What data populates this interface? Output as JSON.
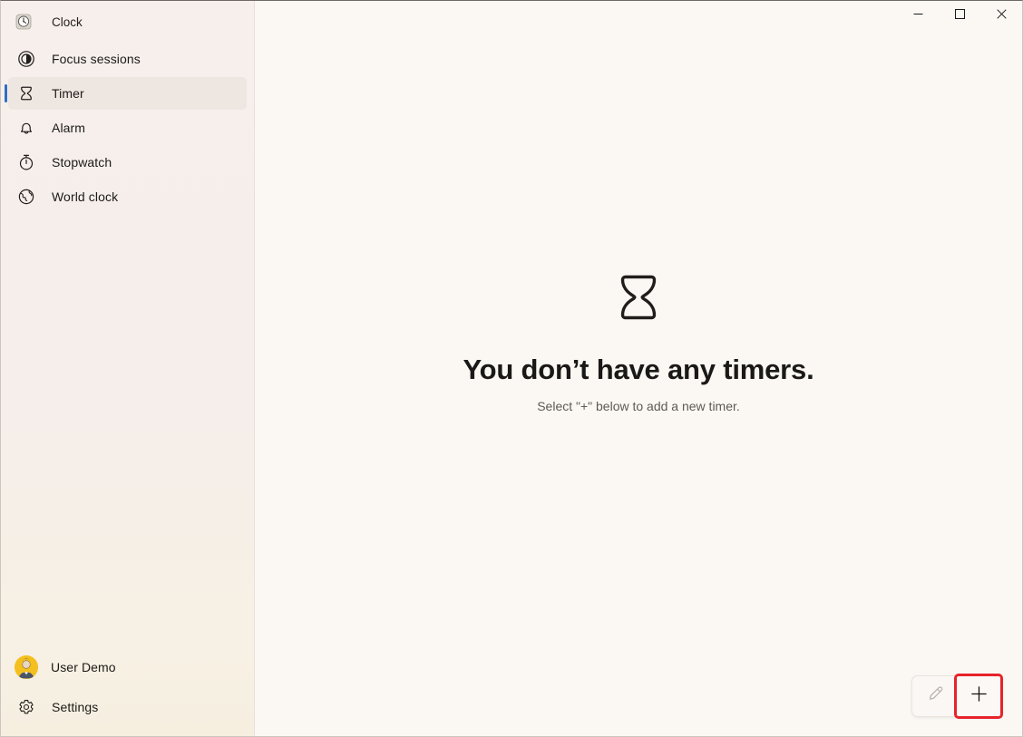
{
  "window": {
    "app_title": "Clock",
    "app_icon": "clock-app-icon"
  },
  "caption": {
    "minimize_label": "Minimize",
    "minimize_icon": "minimize-icon",
    "maximize_label": "Maximize",
    "maximize_icon": "maximize-icon",
    "close_label": "Close",
    "close_icon": "close-icon"
  },
  "sidebar": {
    "items": [
      {
        "label": "Focus sessions",
        "icon": "focus-sessions-icon",
        "selected": false
      },
      {
        "label": "Timer",
        "icon": "hourglass-icon",
        "selected": true
      },
      {
        "label": "Alarm",
        "icon": "bell-icon",
        "selected": false
      },
      {
        "label": "Stopwatch",
        "icon": "stopwatch-icon",
        "selected": false
      },
      {
        "label": "World clock",
        "icon": "globe-icon",
        "selected": false
      }
    ],
    "footer": {
      "account_label": "User Demo",
      "account_icon": "avatar",
      "settings_label": "Settings",
      "settings_icon": "gear-icon"
    }
  },
  "main": {
    "empty_state": {
      "icon": "hourglass-icon",
      "title": "You don’t have any timers.",
      "subtitle": "Select \"+\" below to add a new timer."
    }
  },
  "command_bar": {
    "edit_label": "Edit timers",
    "edit_icon": "pencil-icon",
    "add_label": "Add new timer",
    "add_icon": "plus-icon"
  },
  "colors": {
    "accent": "#2f6fc0",
    "highlight_outline": "#e8232a",
    "sidebar_bg": "#f6efeb",
    "content_bg": "#fbf8f4",
    "avatar_bg": "#f4c01f"
  }
}
